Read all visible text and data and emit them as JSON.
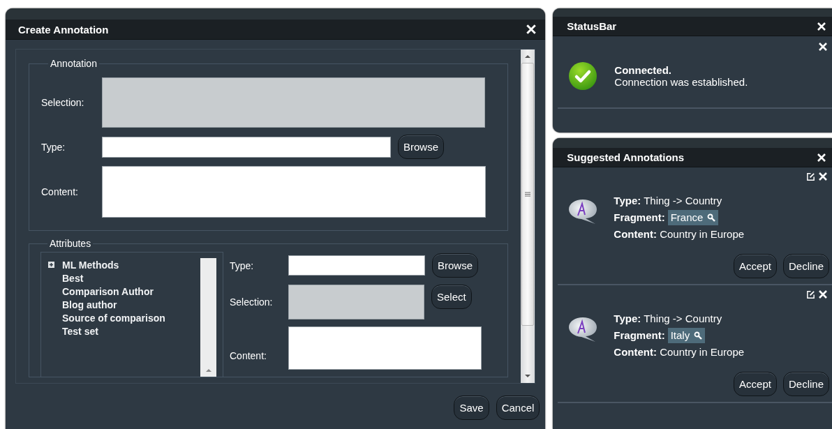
{
  "dialog": {
    "title": "Create Annotation",
    "annotation": {
      "legend": "Annotation",
      "fields": [
        {
          "label": "Selection:",
          "kind": "readonly"
        },
        {
          "label": "Type:",
          "kind": "text",
          "button": "Browse"
        },
        {
          "label": "Content:",
          "kind": "textarea"
        }
      ]
    },
    "attributes": {
      "legend": "Attributes",
      "tree": [
        {
          "label": "ML Methods",
          "kind": "group"
        },
        {
          "label": "Best",
          "kind": "leaf"
        },
        {
          "label": "Comparison Author",
          "kind": "leaf"
        },
        {
          "label": "Blog author",
          "kind": "leaf"
        },
        {
          "label": "Source of comparison",
          "kind": "leaf"
        },
        {
          "label": "Test set",
          "kind": "leaf"
        }
      ],
      "fields": [
        {
          "label": "Type:",
          "kind": "text",
          "button": "Browse"
        },
        {
          "label": "Selection:",
          "kind": "readonly",
          "button": "Select"
        },
        {
          "label": "Content:",
          "kind": "textarea"
        }
      ]
    },
    "buttons": [
      "Save",
      "Cancel"
    ]
  },
  "status_panel": {
    "title": "StatusBar",
    "message": {
      "title": "Connected.",
      "text": "Connection was established."
    }
  },
  "suggestions_panel": {
    "title": "Suggested Annotations",
    "items": [
      {
        "type": "**Type:** Thing -> Country",
        "fragment_label": "Fragment:",
        "fragment": "France",
        "content": "**Content:** Country in Europe",
        "buttons": [
          "Accept",
          "Decline"
        ]
      },
      {
        "type": "**Type:** Thing -> Country",
        "fragment_label": "Fragment:",
        "fragment": "Italy",
        "content": "**Content:** Country in Europe",
        "buttons": [
          "Accept",
          "Decline"
        ]
      }
    ]
  }
}
